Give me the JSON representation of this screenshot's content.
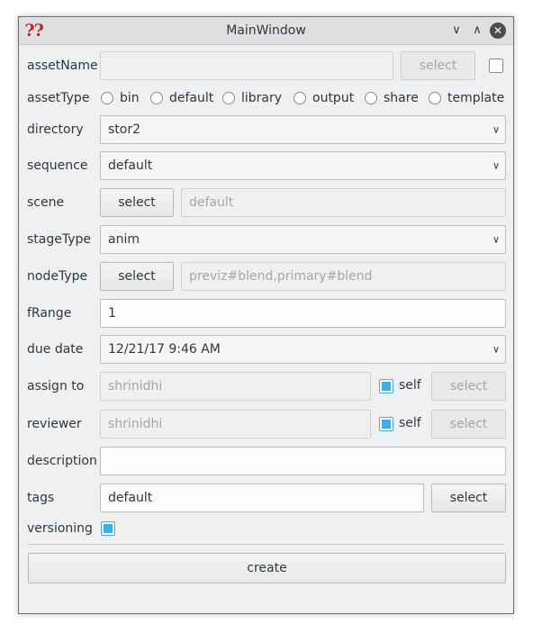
{
  "window": {
    "title": "MainWindow"
  },
  "assetName": {
    "label": "assetName",
    "value": "",
    "select_label": "select"
  },
  "assetType": {
    "label": "assetType",
    "options": [
      "bin",
      "default",
      "library",
      "output",
      "share",
      "template"
    ]
  },
  "directory": {
    "label": "directory",
    "value": "stor2"
  },
  "sequence": {
    "label": "sequence",
    "value": "default"
  },
  "scene": {
    "label": "scene",
    "select_label": "select",
    "placeholder": "default"
  },
  "stageType": {
    "label": "stageType",
    "value": "anim"
  },
  "nodeType": {
    "label": "nodeType",
    "select_label": "select",
    "placeholder": "previz#blend,primary#blend"
  },
  "fRange": {
    "label": "fRange",
    "value": "1"
  },
  "dueDate": {
    "label": "due date",
    "value": "12/21/17 9:46 AM"
  },
  "assignTo": {
    "label": "assign to",
    "value": "shrinidhi",
    "self_label": "self",
    "self_checked": true,
    "select_label": "select"
  },
  "reviewer": {
    "label": "reviewer",
    "value": "shrinidhi",
    "self_label": "self",
    "self_checked": true,
    "select_label": "select"
  },
  "description": {
    "label": "description",
    "value": ""
  },
  "tags": {
    "label": "tags",
    "value": "default",
    "select_label": "select"
  },
  "versioning": {
    "label": "versioning",
    "checked": true
  },
  "create_label": "create",
  "colors": {
    "accent": "#3daee9",
    "window_bg": "#eff0f1",
    "icon_red": "#d21f1f"
  }
}
